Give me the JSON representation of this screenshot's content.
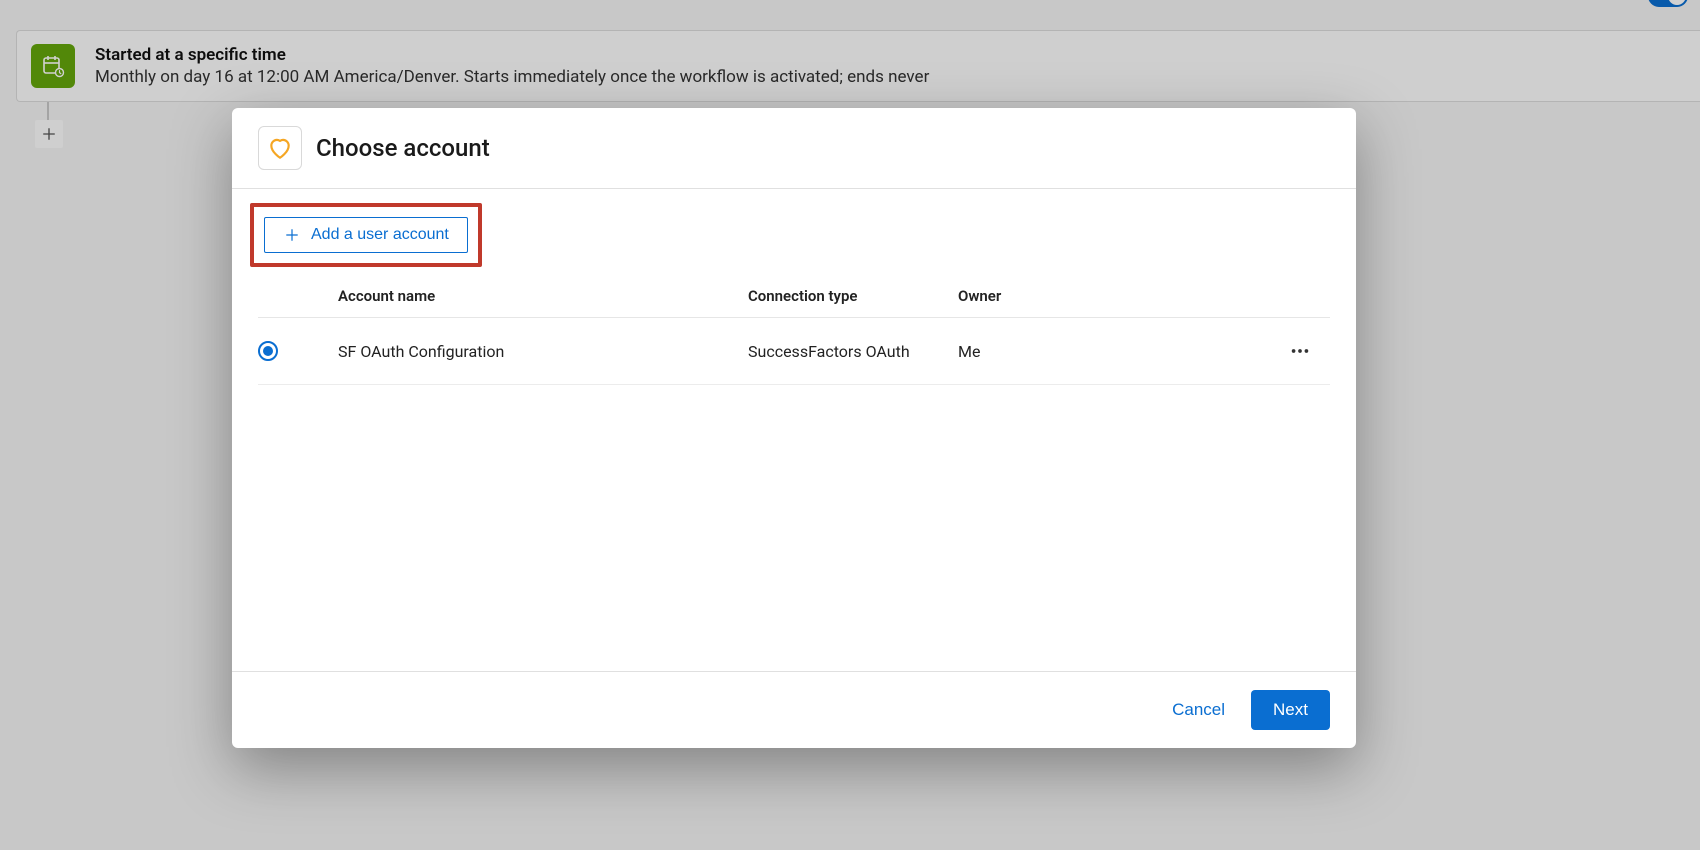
{
  "background_step": {
    "title": "Started at a specific time",
    "subtitle": "Monthly on day 16 at 12:00 AM America/Denver. Starts immediately once the workflow is activated; ends never"
  },
  "modal": {
    "title": "Choose account",
    "add_button_label": "Add a user account",
    "columns": {
      "account_name": "Account name",
      "connection_type": "Connection type",
      "owner": "Owner"
    },
    "rows": [
      {
        "selected": true,
        "account_name": "SF OAuth Configuration",
        "connection_type": "SuccessFactors OAuth",
        "owner": "Me"
      }
    ],
    "footer": {
      "cancel_label": "Cancel",
      "next_label": "Next"
    }
  },
  "colors": {
    "accent": "#0a6ed1",
    "highlight_border": "#c0392b",
    "step_icon_bg": "#64a70b",
    "heart_icon": "#f5a623"
  }
}
